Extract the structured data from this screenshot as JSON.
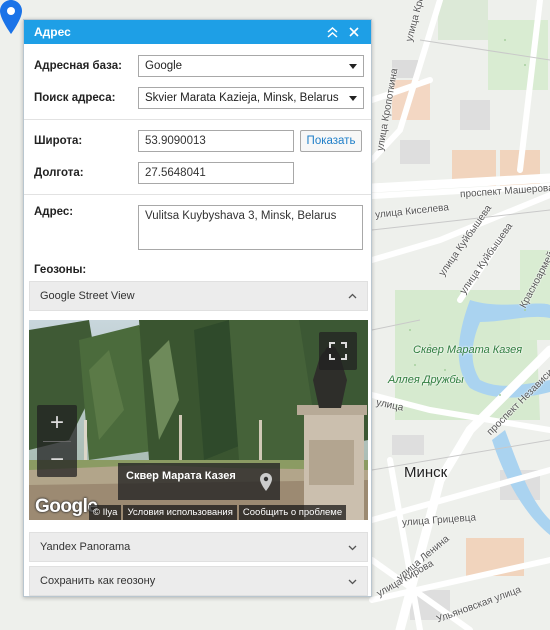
{
  "panel": {
    "title": "Адрес",
    "address_base_label": "Адресная база:",
    "address_base_value": "Google",
    "search_label": "Поиск адреса:",
    "search_value": "Skvier Marata Kazieja, Minsk, Belarus",
    "latitude_label": "Широта:",
    "latitude_value": "53.9090013",
    "longitude_label": "Долгота:",
    "longitude_value": "27.5648041",
    "show_button": "Показать",
    "address_label": "Адрес:",
    "address_value": "Vulitsa Kuybyshava 3, Minsk, Belarus",
    "geozones_label": "Геозоны:"
  },
  "sections": {
    "street_view": "Google Street View",
    "yandex": "Yandex Panorama",
    "save_geozone": "Сохранить как геозону"
  },
  "streetview": {
    "place_name": "Сквер Марата Казея",
    "logo": "Google",
    "copyright": "© Ilya",
    "terms": "Условия использования",
    "report": "Сообщить о проблеме",
    "zoom_in": "+",
    "zoom_out": "−"
  },
  "map": {
    "labels": {
      "street_krop": "улица Кропоткина",
      "street_krop2": "улица Кропоткина",
      "mashera": "проспект Машерова",
      "kiseleva": "улица Киселева",
      "kuibysheva": "улица Куйбышева",
      "kuibysheva2": "улица Куйбышева",
      "krasnoarm": "Красноармейская улица",
      "park": "Сквер Марата Казея",
      "druzhby": "Аллея Дружбы",
      "nezavisimosti": "проспект Независимости",
      "city": "Минск",
      "gritsevtsa": "улица Грицевца",
      "lenina": "улица Ленина",
      "kirova": "улица Кирова",
      "ulyanovskaya": "Ульяновская улица",
      "ulitsa": "улица"
    },
    "marker_color": "#1a73e8"
  },
  "colors": {
    "accent": "#1e9fe6",
    "show_link": "#1e7ec8"
  }
}
